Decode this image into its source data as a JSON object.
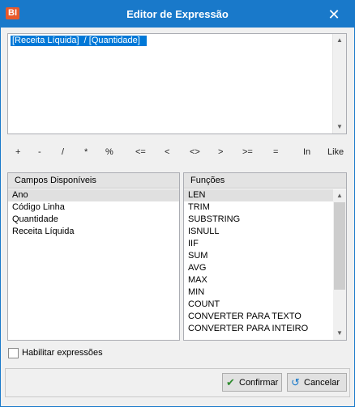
{
  "window": {
    "title": "Editor de Expressão",
    "app_icon_text": "BI",
    "close_glyph": "✕"
  },
  "expression": {
    "text": "[Receita Líquida]  / [Quantidade]  "
  },
  "operators": [
    "+",
    "-",
    "/",
    "*",
    "%",
    "<=",
    "<",
    "<>",
    ">",
    ">=",
    "=",
    "In",
    "Like"
  ],
  "fields_panel": {
    "header": "Campos Disponíveis",
    "items": [
      "Ano",
      "Código Linha",
      "Quantidade",
      "Receita Líquida"
    ],
    "selected_index": 0
  },
  "functions_panel": {
    "header": "Funções",
    "items": [
      "LEN",
      "TRIM",
      "SUBSTRING",
      "ISNULL",
      "IIF",
      "SUM",
      "AVG",
      "MAX",
      "MIN",
      "COUNT",
      "CONVERTER PARA TEXTO",
      "CONVERTER PARA INTEIRO"
    ],
    "selected_index": 0
  },
  "enable_expressions": {
    "label": "Habilitar expressões",
    "checked": false
  },
  "buttons": {
    "confirm": "Confirmar",
    "cancel": "Cancelar"
  },
  "colors": {
    "titlebar": "#1979ca",
    "selection": "#0078d7",
    "app_icon": "#e8592b"
  }
}
